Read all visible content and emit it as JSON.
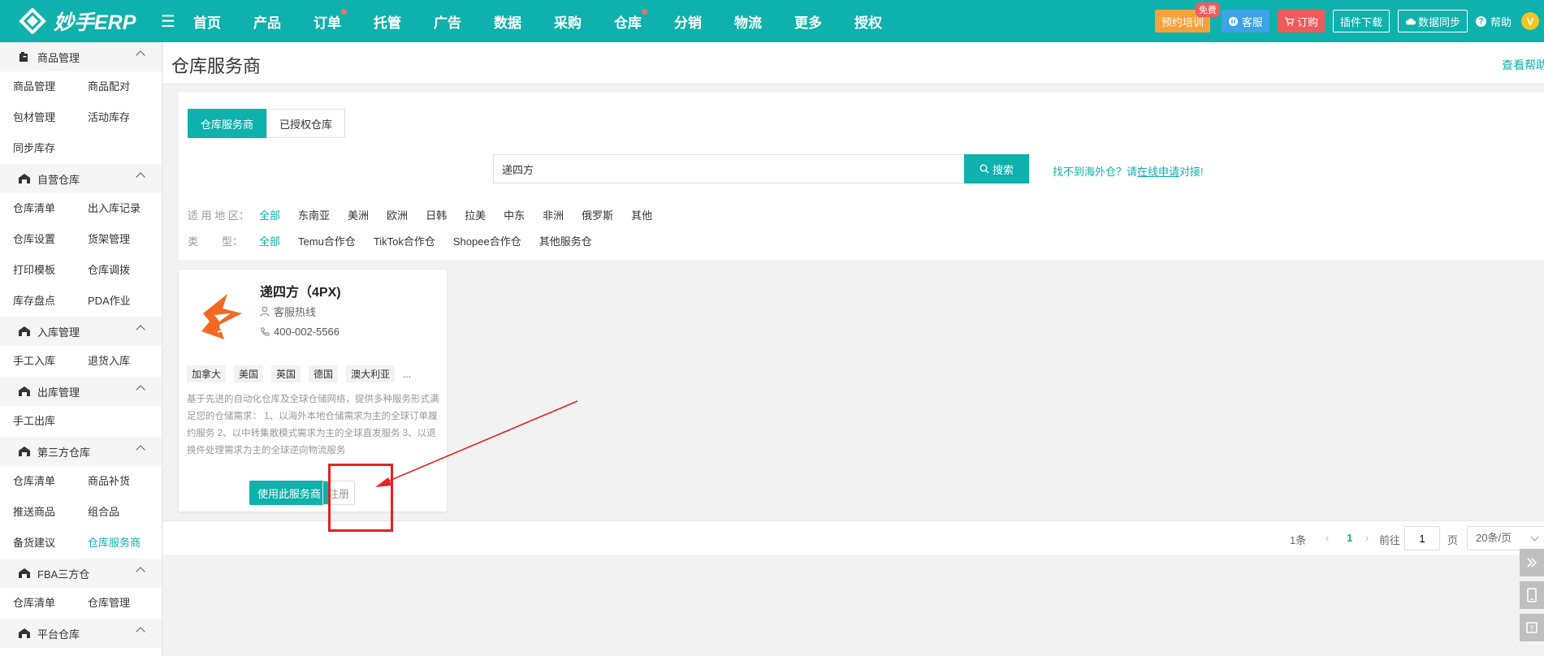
{
  "app": {
    "brand": "妙手ERP",
    "nav": [
      {
        "label": "首页",
        "dot": false
      },
      {
        "label": "产品",
        "dot": false
      },
      {
        "label": "订单",
        "dot": true
      },
      {
        "label": "托管",
        "dot": false
      },
      {
        "label": "广告",
        "dot": false
      },
      {
        "label": "数据",
        "dot": false
      },
      {
        "label": "采购",
        "dot": false
      },
      {
        "label": "仓库",
        "dot": true
      },
      {
        "label": "分销",
        "dot": false
      },
      {
        "label": "物流",
        "dot": false
      },
      {
        "label": "更多",
        "dot": false
      },
      {
        "label": "授权",
        "dot": false
      }
    ],
    "top_buttons": {
      "training": "预约培训",
      "free_badge": "免费",
      "service": "客服",
      "order": "订购",
      "plugin": "插件下载",
      "sync": "数据同步",
      "help": "帮助",
      "vip": "V"
    },
    "colors": {
      "primary": "#0fb1ac",
      "danger": "#ef5b5b",
      "training": "#f6a23a",
      "service": "#3ba3e6"
    }
  },
  "sidebar": {
    "groups": [
      {
        "title": "商品管理",
        "icon": "box-icon",
        "items": [
          "商品管理",
          "商品配对",
          "包材管理",
          "活动库存",
          "同步库存"
        ]
      },
      {
        "title": "自营仓库",
        "icon": "warehouse-icon",
        "items": [
          "仓库清单",
          "出入库记录",
          "仓库设置",
          "货架管理",
          "打印模板",
          "仓库调拨",
          "库存盘点",
          "PDA作业"
        ]
      },
      {
        "title": "入库管理",
        "icon": "warehouse-icon",
        "items": [
          "手工入库",
          "退货入库"
        ]
      },
      {
        "title": "出库管理",
        "icon": "warehouse-icon",
        "items": [
          "手工出库"
        ]
      },
      {
        "title": "第三方仓库",
        "icon": "warehouse-icon",
        "items": [
          "仓库清单",
          "商品补货",
          "推送商品",
          "组合品",
          "备货建议",
          "仓库服务商"
        ]
      },
      {
        "title": "FBA三方仓",
        "icon": "warehouse-icon",
        "items": [
          "仓库清单",
          "仓库管理"
        ]
      },
      {
        "title": "平台仓库",
        "icon": "warehouse-icon",
        "items": []
      }
    ],
    "active_item": "仓库服务商"
  },
  "page": {
    "title": "仓库服务商",
    "help_link": "查看帮助",
    "tabs": [
      "仓库服务商",
      "已授权仓库"
    ],
    "search": {
      "value": "递四方",
      "button": "搜索"
    },
    "not_found": {
      "prefix": "找不到海外仓？请",
      "link": "在线申请",
      "suffix": "对接!"
    },
    "region_filter": {
      "label": "适 用 地 区：",
      "options": [
        "全部",
        "东南亚",
        "美洲",
        "欧洲",
        "日韩",
        "拉美",
        "中东",
        "非洲",
        "俄罗斯",
        "其他"
      ]
    },
    "type_filter": {
      "label": "类        型：",
      "options": [
        "全部",
        "Temu合作仓",
        "TikTok合作仓",
        "Shopee合作仓",
        "其他服务仓"
      ]
    }
  },
  "provider": {
    "name": "递四方（4PX)",
    "hotline_label": "客服热线",
    "phone": "400-002-5566",
    "tags": [
      "加拿大",
      "美国",
      "英国",
      "德国",
      "澳大利亚"
    ],
    "tags_more": "...",
    "description": "基于先进的自动化仓库及全球仓储网络，提供多种服务形式满足您的仓储需求： 1、以海外本地仓储需求为主的全球订单履约服务 2、以中转集散模式需求为主的全球直发服务 3、以退换件处理需求为主的全球逆向物流服务",
    "use_button": "使用此服务商",
    "register_button": "注册"
  },
  "pagination": {
    "total": "1条",
    "current_page": "1",
    "goto_label": "前往",
    "goto_value": "1",
    "page_unit": "页",
    "page_size": "20条/页"
  }
}
